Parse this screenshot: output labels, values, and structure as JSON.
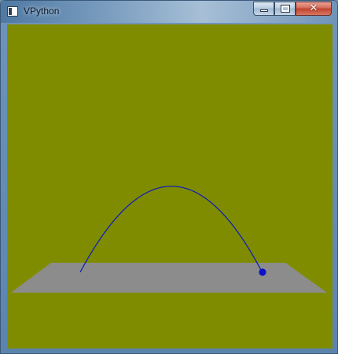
{
  "window": {
    "title": "VPython",
    "icon": "vpython-window-icon",
    "controls": {
      "minimize_icon": "minimize-icon",
      "maximize_icon": "maximize-icon",
      "close_icon": "close-icon",
      "close_glyph": "✕"
    }
  },
  "scene": {
    "background_color": "#808C00",
    "floor_color": "#8C8C8C",
    "trail_color": "#1020B0",
    "ball_color": "#1010CC"
  }
}
